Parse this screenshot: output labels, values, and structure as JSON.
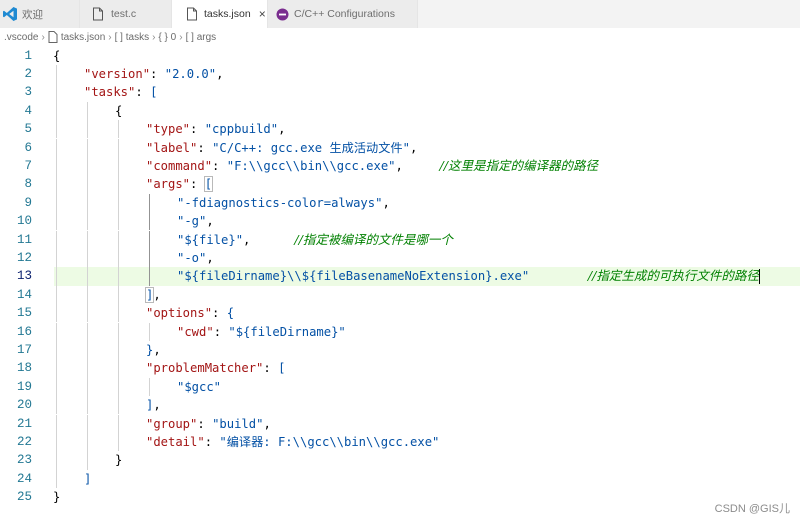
{
  "tabs": [
    {
      "label": "欢迎",
      "icon": "vscode-logo-icon",
      "active": false
    },
    {
      "label": "test.c",
      "icon": "file-icon",
      "active": false
    },
    {
      "label": "tasks.json",
      "icon": "file-icon",
      "active": true,
      "close": "×"
    },
    {
      "label": "C/C++ Configurations",
      "icon": "cpp-extension-icon",
      "active": false
    }
  ],
  "breadcrumb": [
    ".vscode",
    "tasks.json",
    "[ ] tasks",
    "{ } 0",
    "[ ] args"
  ],
  "code_lines": [
    {
      "n": "1",
      "indent": 0,
      "tokens": [
        [
          "p",
          "{"
        ]
      ]
    },
    {
      "n": "2",
      "indent": 1,
      "tokens": [
        [
          "k",
          "\"version\""
        ],
        [
          "p",
          ": "
        ],
        [
          "s",
          "\"2.0.0\""
        ],
        [
          "p",
          ","
        ]
      ]
    },
    {
      "n": "3",
      "indent": 1,
      "tokens": [
        [
          "k",
          "\"tasks\""
        ],
        [
          "p",
          ": "
        ],
        [
          "s",
          "["
        ]
      ]
    },
    {
      "n": "4",
      "indent": 2,
      "tokens": [
        [
          "p",
          "{"
        ]
      ]
    },
    {
      "n": "5",
      "indent": 3,
      "tokens": [
        [
          "k",
          "\"type\""
        ],
        [
          "p",
          ": "
        ],
        [
          "s",
          "\"cppbuild\""
        ],
        [
          "p",
          ","
        ]
      ]
    },
    {
      "n": "6",
      "indent": 3,
      "tokens": [
        [
          "k",
          "\"label\""
        ],
        [
          "p",
          ": "
        ],
        [
          "s",
          "\"C/C++: gcc.exe 生成活动文件\""
        ],
        [
          "p",
          ","
        ]
      ]
    },
    {
      "n": "7",
      "indent": 3,
      "tokens": [
        [
          "k",
          "\"command\""
        ],
        [
          "p",
          ": "
        ],
        [
          "s",
          "\"F:\\\\gcc\\\\bin\\\\gcc.exe\""
        ],
        [
          "p",
          ",     "
        ],
        [
          "c",
          "//这里是指定的编译器的路径"
        ]
      ]
    },
    {
      "n": "8",
      "indent": 3,
      "tokens": [
        [
          "k",
          "\"args\""
        ],
        [
          "p",
          ": "
        ],
        [
          "s",
          "["
        ]
      ]
    },
    {
      "n": "9",
      "indent": 4,
      "tokens": [
        [
          "s",
          "\"-fdiagnostics-color=always\""
        ],
        [
          "p",
          ","
        ]
      ]
    },
    {
      "n": "10",
      "indent": 4,
      "tokens": [
        [
          "s",
          "\"-g\""
        ],
        [
          "p",
          ","
        ]
      ]
    },
    {
      "n": "11",
      "indent": 4,
      "tokens": [
        [
          "s",
          "\"${file}\""
        ],
        [
          "p",
          ",      "
        ],
        [
          "c",
          "//指定被编译的文件是哪一个"
        ]
      ]
    },
    {
      "n": "12",
      "indent": 4,
      "tokens": [
        [
          "s",
          "\"-o\""
        ],
        [
          "p",
          ","
        ]
      ]
    },
    {
      "n": "13",
      "indent": 4,
      "tokens": [
        [
          "s",
          "\"${fileDirname}\\\\${fileBasenameNoExtension}.exe\""
        ],
        [
          "p",
          "        "
        ],
        [
          "c",
          "//指定生成的可执行文件的路径"
        ]
      ]
    },
    {
      "n": "14",
      "indent": 3,
      "tokens": [
        [
          "s",
          "]"
        ],
        [
          "p",
          ","
        ]
      ]
    },
    {
      "n": "15",
      "indent": 3,
      "tokens": [
        [
          "k",
          "\"options\""
        ],
        [
          "p",
          ": "
        ],
        [
          "s",
          "{"
        ]
      ]
    },
    {
      "n": "16",
      "indent": 4,
      "tokens": [
        [
          "k",
          "\"cwd\""
        ],
        [
          "p",
          ": "
        ],
        [
          "s",
          "\"${fileDirname}\""
        ]
      ]
    },
    {
      "n": "17",
      "indent": 3,
      "tokens": [
        [
          "s",
          "}"
        ],
        [
          "p",
          ","
        ]
      ]
    },
    {
      "n": "18",
      "indent": 3,
      "tokens": [
        [
          "k",
          "\"problemMatcher\""
        ],
        [
          "p",
          ": "
        ],
        [
          "s",
          "["
        ]
      ]
    },
    {
      "n": "19",
      "indent": 4,
      "tokens": [
        [
          "s",
          "\"$gcc\""
        ]
      ]
    },
    {
      "n": "20",
      "indent": 3,
      "tokens": [
        [
          "s",
          "]"
        ],
        [
          "p",
          ","
        ]
      ]
    },
    {
      "n": "21",
      "indent": 3,
      "tokens": [
        [
          "k",
          "\"group\""
        ],
        [
          "p",
          ": "
        ],
        [
          "s",
          "\"build\""
        ],
        [
          "p",
          ","
        ]
      ]
    },
    {
      "n": "22",
      "indent": 3,
      "tokens": [
        [
          "k",
          "\"detail\""
        ],
        [
          "p",
          ": "
        ],
        [
          "s",
          "\"编译器: F:\\\\gcc\\\\bin\\\\gcc.exe\""
        ]
      ]
    },
    {
      "n": "23",
      "indent": 2,
      "tokens": [
        [
          "p",
          "}"
        ]
      ]
    },
    {
      "n": "24",
      "indent": 1,
      "tokens": [
        [
          "s",
          "]"
        ]
      ]
    },
    {
      "n": "25",
      "indent": 0,
      "tokens": [
        [
          "p",
          "}"
        ]
      ]
    }
  ],
  "current_line": 13,
  "watermark": "CSDN @GIS儿",
  "colors": {
    "key": "#a31515",
    "string": "#0451a5",
    "comment": "#008000",
    "line_number": "#237893",
    "current_line_bg": "#edfbe4"
  }
}
